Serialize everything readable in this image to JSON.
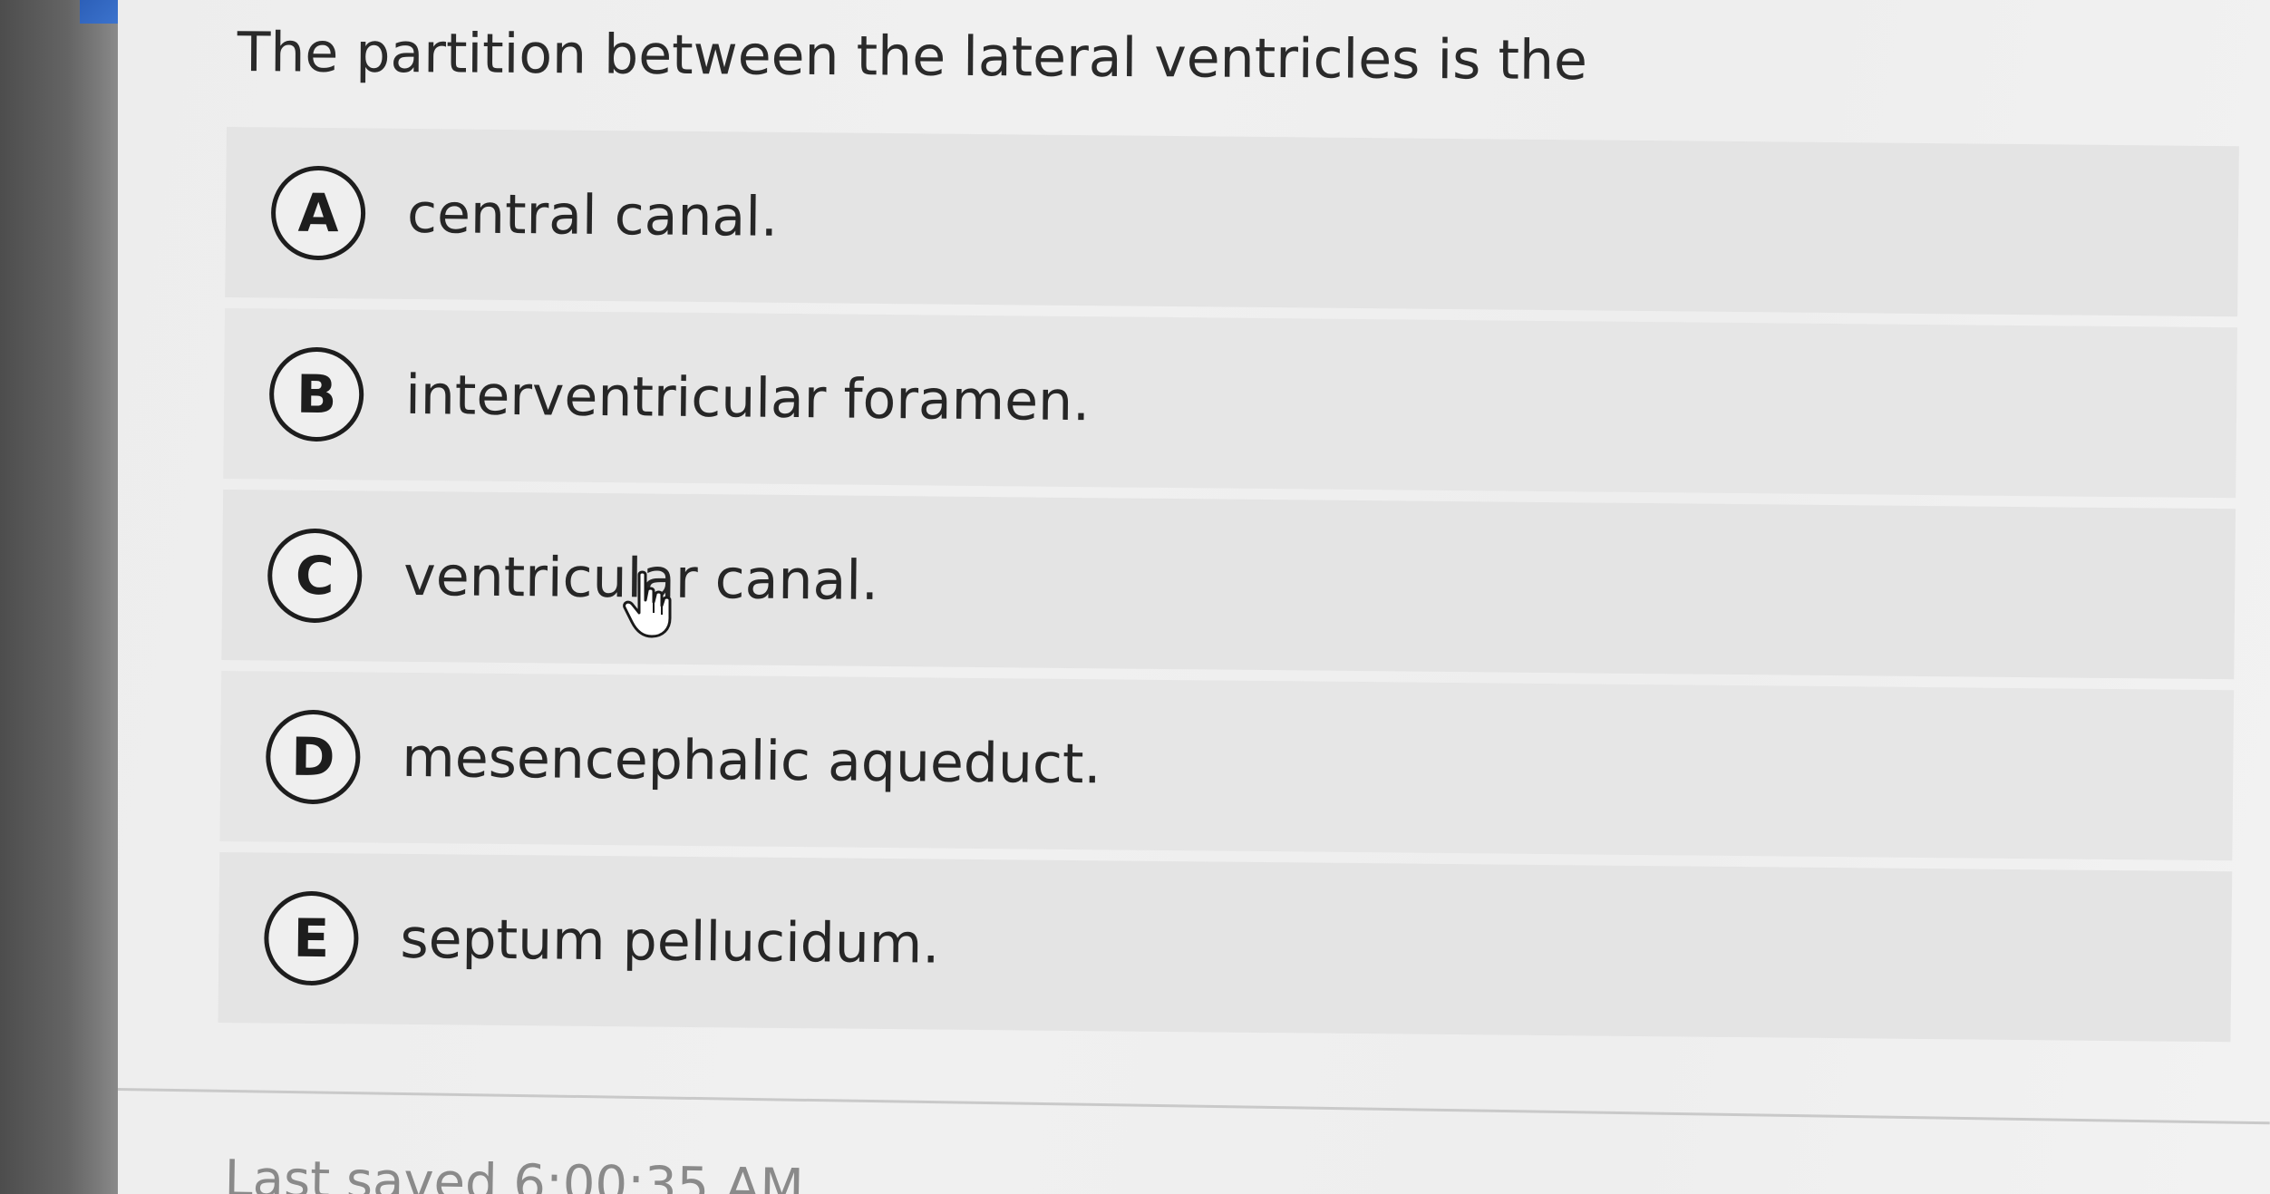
{
  "question": {
    "text": "The partition between the lateral ventricles is the"
  },
  "options": [
    {
      "letter": "A",
      "text": "central canal."
    },
    {
      "letter": "B",
      "text": "interventricular foramen."
    },
    {
      "letter": "C",
      "text": "ventricular canal."
    },
    {
      "letter": "D",
      "text": "mesencephalic aqueduct."
    },
    {
      "letter": "E",
      "text": "septum pellucidum."
    }
  ],
  "footer": {
    "status": "Last saved 6:00:35 AM"
  },
  "icons": {
    "cursor": "hand-pointer-icon"
  },
  "colors": {
    "screen_background": "#eeeeee",
    "option_background": "#e5e5e5",
    "text": "#262626",
    "bubble_border": "#1d1d1d"
  }
}
